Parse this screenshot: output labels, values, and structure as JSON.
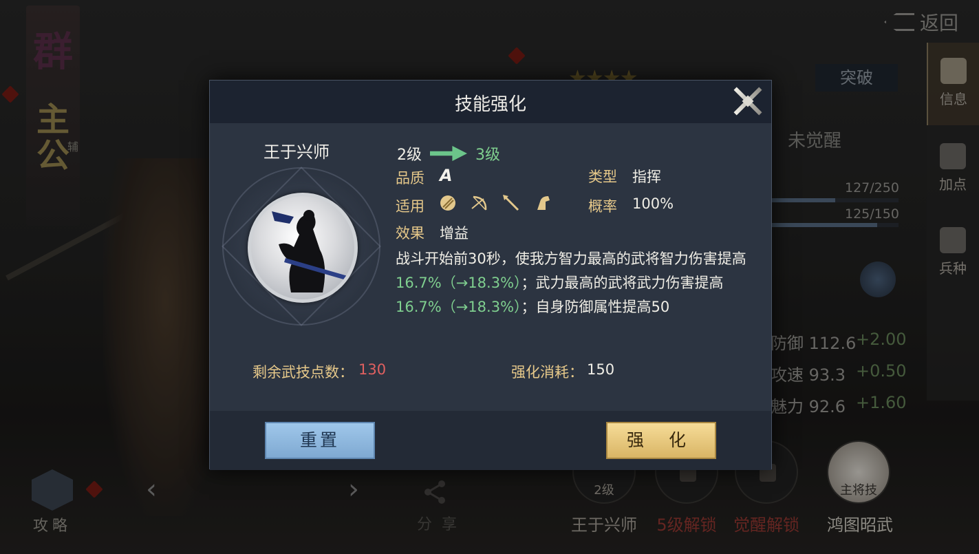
{
  "screen": {
    "back_label": "返回",
    "faction_char": "群",
    "hero_role": "主公",
    "hero_role_sub": "辅",
    "breakout_label": "突破",
    "awaken_status": "未觉醒",
    "bar1_text": "127/250",
    "bar1_fraction": 0.508,
    "bar2_text": "125/150",
    "bar2_fraction": 0.833,
    "stats": [
      {
        "label": "防御",
        "value": "112.6",
        "bonus": "+2.00"
      },
      {
        "label": "攻速",
        "value": "93.3",
        "bonus": "+0.50"
      },
      {
        "label": "魅力",
        "value": "92.6",
        "bonus": "+1.60"
      }
    ],
    "right_tabs": [
      {
        "label": "信息",
        "icon": "scroll-icon"
      },
      {
        "label": "加点",
        "icon": "add-points-icon"
      },
      {
        "label": "兵种",
        "icon": "troop-icon"
      }
    ],
    "skill_slots": [
      {
        "tag": "2级",
        "name": "王于兴师",
        "name_color": "#a9a49a"
      },
      {
        "tag": "",
        "name": "5级解锁",
        "name_color": "#9a3a34"
      },
      {
        "tag": "",
        "name": "觉醒解锁",
        "name_color": "#9a3a34"
      },
      {
        "tag": "主将技",
        "name": "鸿图昭武",
        "name_color": "#d8d4ca"
      }
    ],
    "guide_label": "攻略",
    "share_label": "分享"
  },
  "dialog": {
    "title": "技能强化",
    "skill_name": "王于兴师",
    "level_from": "2级",
    "level_to": "3级",
    "quality_label": "品质",
    "quality_value": "A",
    "type_label": "类型",
    "type_value": "指挥",
    "apply_label": "适用",
    "apply_icons": [
      "shield-unit-icon",
      "bow-unit-icon",
      "spear-unit-icon",
      "cavalry-unit-icon"
    ],
    "chance_label": "概率",
    "chance_value": "100%",
    "effect_label": "效果",
    "effect_value": "增益",
    "description": {
      "p1": "战斗开始前30秒，使我方智力最高的武将智力伤害提高",
      "g1": "16.7%（→18.3%）",
      "p2": "；武力最高的武将武力伤害提高",
      "g2": "16.7%（→18.3%）",
      "p3": "；自身防御属性提高50"
    },
    "points_label": "剩余武技点数：",
    "points_value": "130",
    "cost_label": "强化消耗：",
    "cost_value": "150",
    "reset_label": "重置",
    "enhance_label": "强 化"
  }
}
